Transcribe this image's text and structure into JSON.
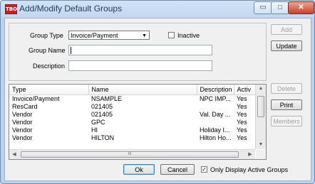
{
  "window": {
    "title": "Add/Modify Default Groups",
    "app_icon_text": "TBO"
  },
  "titlebar_buttons": {
    "minimize": "▭",
    "maximize": "□",
    "close": "✕"
  },
  "form": {
    "group_type_label": "Group Type",
    "group_type_value": "Invoice/Payment",
    "inactive_label": "Inactive",
    "inactive_checked": false,
    "group_name_label": "Group Name",
    "group_name_value": "",
    "description_label": "Description",
    "description_value": ""
  },
  "side_buttons": {
    "add": "Add",
    "update": "Update",
    "delete": "Delete",
    "print": "Print",
    "members": "Members"
  },
  "list": {
    "columns": [
      "Type",
      "Name",
      "Description",
      "Active"
    ],
    "columns_visible": [
      "Type",
      "Name",
      "Description",
      "Activ"
    ],
    "rows": [
      [
        "Invoice/Payment",
        "NSAMPLE",
        "NPC IMP...",
        "Yes"
      ],
      [
        "ResCard",
        "021405",
        "",
        "Yes"
      ],
      [
        "Vendor",
        "021405",
        "Val. Day ...",
        "Yes"
      ],
      [
        "Vendor",
        "GPC",
        "",
        "Yes"
      ],
      [
        "Vendor",
        "HI",
        "Holiday I...",
        "Yes"
      ],
      [
        "Vendor",
        "HILTON",
        "Hilton Ho...",
        "Yes"
      ]
    ],
    "hscroll_grip": "III"
  },
  "footer": {
    "ok": "Ok",
    "cancel": "Cancel",
    "only_active_label": "Only Display Active Groups",
    "only_active_checked": true
  }
}
